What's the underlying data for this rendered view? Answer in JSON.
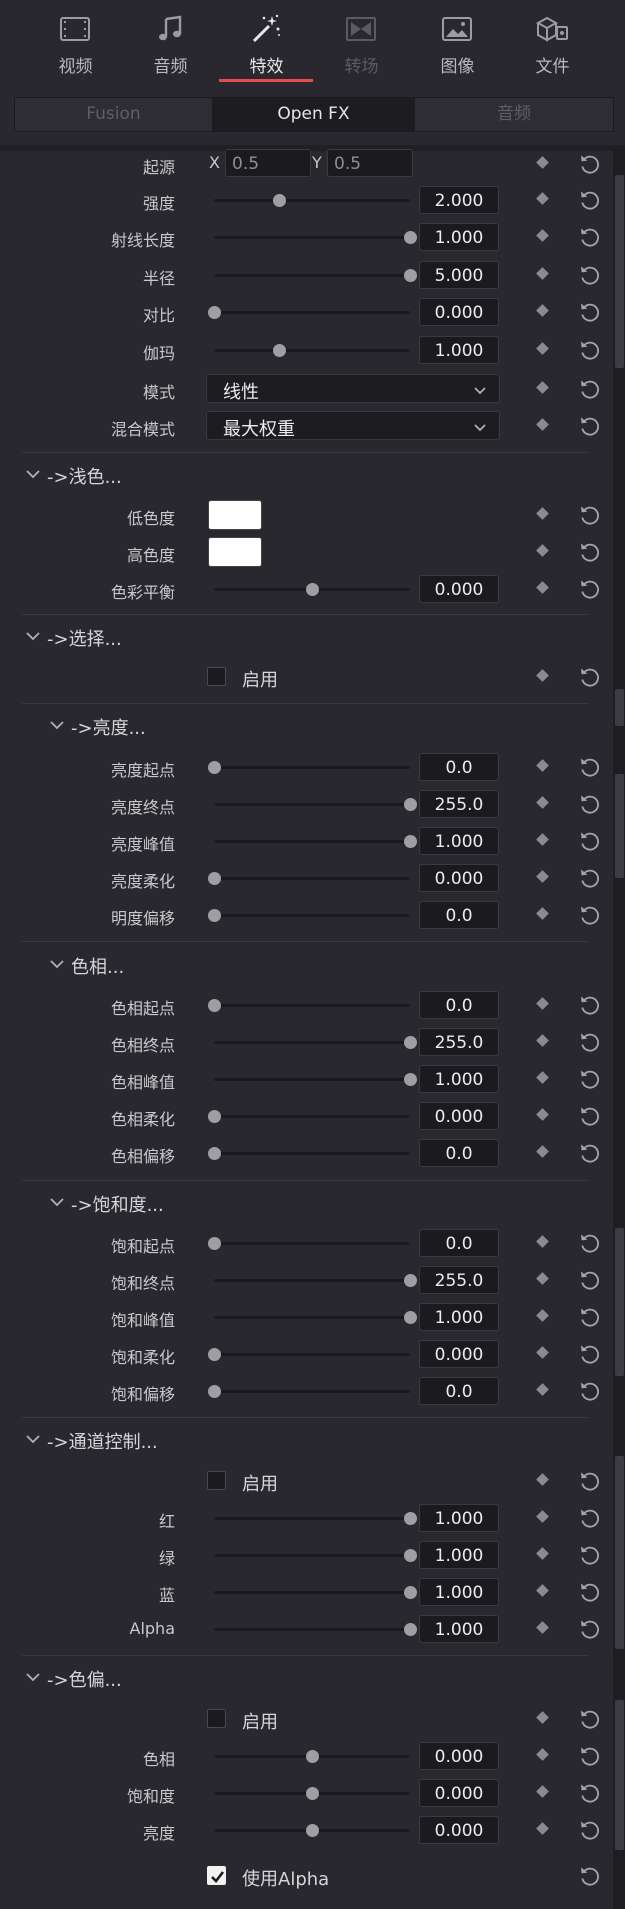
{
  "tabs": [
    {
      "label": "视频",
      "icon": "film-strip-icon",
      "state": "normal"
    },
    {
      "label": "音频",
      "icon": "music-note-icon",
      "state": "normal"
    },
    {
      "label": "特效",
      "icon": "magic-wand-icon",
      "state": "active"
    },
    {
      "label": "转场",
      "icon": "transition-icon",
      "state": "disabled"
    },
    {
      "label": "图像",
      "icon": "image-icon",
      "state": "normal"
    },
    {
      "label": "文件",
      "icon": "file-icon",
      "state": "normal"
    }
  ],
  "subtabs": [
    {
      "label": "Fusion",
      "state": "disabled"
    },
    {
      "label": "Open FX",
      "state": "active"
    },
    {
      "label": "音频",
      "state": "disabled"
    }
  ],
  "origin": {
    "label": "起源",
    "x_label": "X",
    "x_value": "0.5",
    "y_label": "Y",
    "y_value": "0.5"
  },
  "params_top": [
    {
      "label": "强度",
      "value": "2.000",
      "level": 0.33
    },
    {
      "label": "射线长度",
      "value": "1.000",
      "level": 1.0
    },
    {
      "label": "半径",
      "value": "5.000",
      "level": 1.0
    },
    {
      "label": "对比",
      "value": "0.000",
      "level": 0.0
    },
    {
      "label": "伽玛",
      "value": "1.000",
      "level": 0.33
    }
  ],
  "mode": {
    "label": "模式",
    "value": "线性"
  },
  "blend_mode": {
    "label": "混合模式",
    "value": "最大权重"
  },
  "sections": {
    "tint": "->浅色...",
    "select": "->选择...",
    "luma": "->亮度...",
    "hue": "色相...",
    "sat": "->饱和度...",
    "channel": "->通道控制...",
    "cast": "->色偏..."
  },
  "tint": {
    "low_label": "低色度",
    "high_label": "高色度",
    "low_color": "#ffffff",
    "high_color": "#ffffff",
    "balance": {
      "label": "色彩平衡",
      "value": "0.000",
      "level": 0.5
    }
  },
  "select_enable": {
    "label": "启用",
    "checked": false
  },
  "luma": [
    {
      "label": "亮度起点",
      "value": "0.0",
      "level": 0.0
    },
    {
      "label": "亮度终点",
      "value": "255.0",
      "level": 1.0
    },
    {
      "label": "亮度峰值",
      "value": "1.000",
      "level": 1.0
    },
    {
      "label": "亮度柔化",
      "value": "0.000",
      "level": 0.0
    },
    {
      "label": "明度偏移",
      "value": "0.0",
      "level": 0.0
    }
  ],
  "hue": [
    {
      "label": "色相起点",
      "value": "0.0",
      "level": 0.0
    },
    {
      "label": "色相终点",
      "value": "255.0",
      "level": 1.0
    },
    {
      "label": "色相峰值",
      "value": "1.000",
      "level": 1.0
    },
    {
      "label": "色相柔化",
      "value": "0.000",
      "level": 0.0
    },
    {
      "label": "色相偏移",
      "value": "0.0",
      "level": 0.0
    }
  ],
  "sat": [
    {
      "label": "饱和起点",
      "value": "0.0",
      "level": 0.0
    },
    {
      "label": "饱和终点",
      "value": "255.0",
      "level": 1.0
    },
    {
      "label": "饱和峰值",
      "value": "1.000",
      "level": 1.0
    },
    {
      "label": "饱和柔化",
      "value": "0.000",
      "level": 0.0
    },
    {
      "label": "饱和偏移",
      "value": "0.0",
      "level": 0.0
    }
  ],
  "channel_enable": {
    "label": "启用",
    "checked": false
  },
  "channel": [
    {
      "label": "红",
      "value": "1.000",
      "level": 1.0
    },
    {
      "label": "绿",
      "value": "1.000",
      "level": 1.0
    },
    {
      "label": "蓝",
      "value": "1.000",
      "level": 1.0
    },
    {
      "label": "Alpha",
      "value": "1.000",
      "level": 1.0
    }
  ],
  "cast_enable": {
    "label": "启用",
    "checked": false
  },
  "cast": [
    {
      "label": "色相",
      "value": "0.000",
      "level": 0.5
    },
    {
      "label": "饱和度",
      "value": "0.000",
      "level": 0.5
    },
    {
      "label": "亮度",
      "value": "0.000",
      "level": 0.5
    }
  ],
  "use_alpha": {
    "label": "使用Alpha",
    "checked": true
  }
}
